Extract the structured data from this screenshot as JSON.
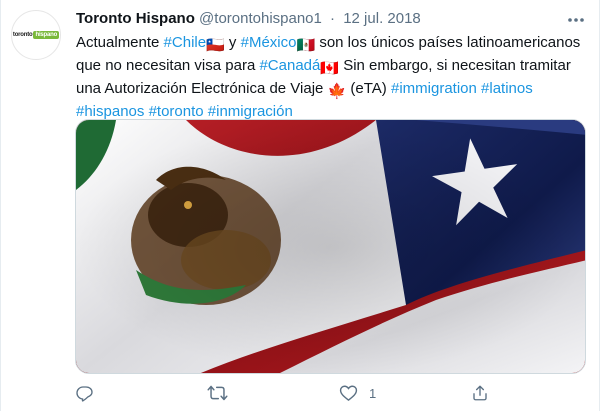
{
  "tweet": {
    "author": {
      "name": "Toronto Hispano",
      "handle": "@torontohispano1",
      "avatar_logo_text_1": "toronto",
      "avatar_logo_text_2": "hispano",
      "avatar_icon": "toronto-hispano-logo"
    },
    "separator": "·",
    "date": "12 jul. 2018",
    "text": {
      "t1": "Actualmente ",
      "h1": "#Chile",
      "e1": "🇨🇱",
      "t2": " y ",
      "h2": "#México",
      "e2": "🇲🇽",
      "t3": " son los únicos países latinoamericanos que no necesitan visa para ",
      "h3": "#Canadá",
      "e3": "🇨🇦",
      "t4": " Sin embargo, si necesitan tramitar una Autorización Electrónica de Viaje ",
      "e4": "🍁",
      "t5": " (eTA) ",
      "h4": "#immigration",
      "t6": " ",
      "h5": "#latinos",
      "t7": " ",
      "h6": "#hispanos",
      "t8": " ",
      "h7": "#toronto",
      "t9": " ",
      "h8": "#inmigración"
    },
    "media": {
      "description_icon": "mexico-chile-flags-photo"
    },
    "actions": {
      "reply_icon": "reply-icon",
      "retweet_icon": "retweet-icon",
      "like_icon": "heart-icon",
      "like_count": "1",
      "share_icon": "share-icon"
    }
  },
  "colors": {
    "hashtag": "#1b95e0",
    "secondary_text": "#5b7083",
    "primary_text": "#0f1419",
    "logo_green": "#7ab93b"
  }
}
